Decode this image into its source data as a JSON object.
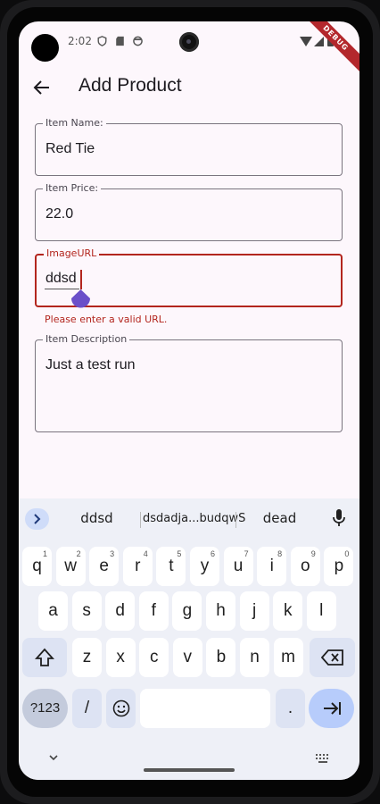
{
  "status_bar": {
    "time": "2:02",
    "debug_banner": "DEBUG"
  },
  "app_bar": {
    "title": "Add Product"
  },
  "form": {
    "name": {
      "label": "Item Name:",
      "value": "Red Tie"
    },
    "price": {
      "label": "Item Price:",
      "value": "22.0"
    },
    "image_url": {
      "label": "ImageURL",
      "value": "ddsd",
      "error": "Please enter a valid URL."
    },
    "description": {
      "label": "Item Description",
      "value": "Just a test run"
    }
  },
  "keyboard": {
    "suggestions": [
      "ddsd",
      "dsdadja...budqwS",
      "dead"
    ],
    "row1": [
      {
        "k": "q",
        "h": "1"
      },
      {
        "k": "w",
        "h": "2"
      },
      {
        "k": "e",
        "h": "3"
      },
      {
        "k": "r",
        "h": "4"
      },
      {
        "k": "t",
        "h": "5"
      },
      {
        "k": "y",
        "h": "6"
      },
      {
        "k": "u",
        "h": "7"
      },
      {
        "k": "i",
        "h": "8"
      },
      {
        "k": "o",
        "h": "9"
      },
      {
        "k": "p",
        "h": "0"
      }
    ],
    "row2": [
      "a",
      "s",
      "d",
      "f",
      "g",
      "h",
      "j",
      "k",
      "l"
    ],
    "row3": [
      "z",
      "x",
      "c",
      "v",
      "b",
      "n",
      "m"
    ],
    "symbols_label": "?123",
    "slash_label": "/",
    "period_label": "."
  },
  "colors": {
    "error": "#b3261e",
    "accent": "#6a4fc9",
    "background": "#fdf7fc"
  },
  "icons": [
    "back-arrow-icon",
    "shield-icon",
    "sd-card-icon",
    "face-icon",
    "wifi-icon",
    "signal-icon",
    "battery-icon",
    "chevron-right-icon",
    "mic-icon",
    "shift-icon",
    "backspace-icon",
    "emoji-icon",
    "enter-tab-icon",
    "chevron-down-icon",
    "keyboard-icon"
  ]
}
